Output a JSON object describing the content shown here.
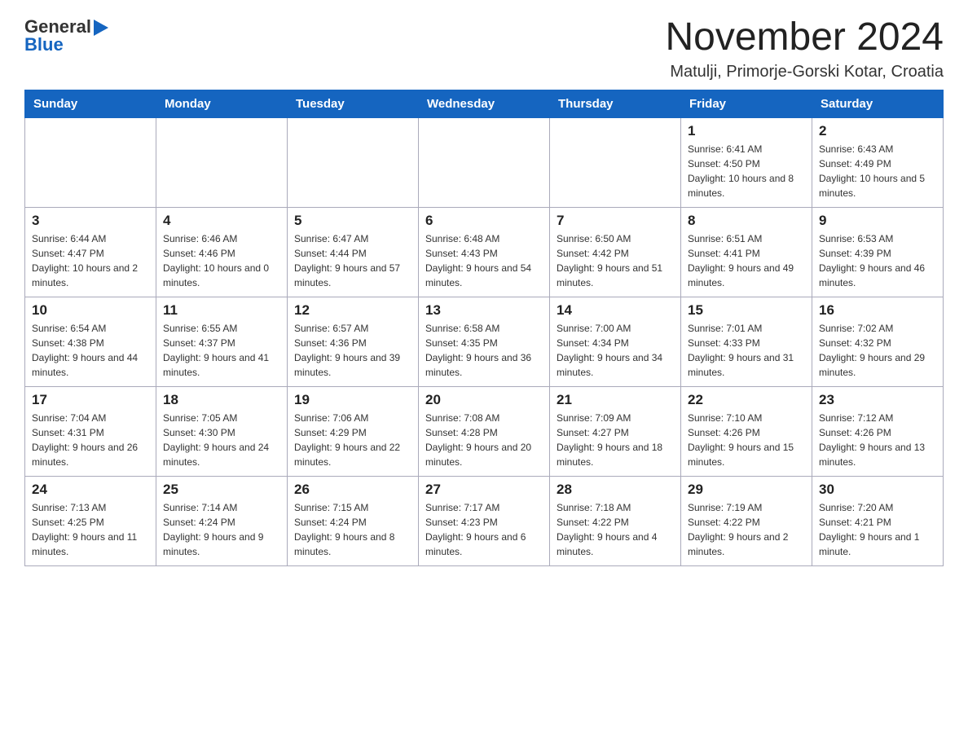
{
  "header": {
    "logo_general": "General",
    "logo_blue": "Blue",
    "month_title": "November 2024",
    "location": "Matulji, Primorje-Gorski Kotar, Croatia"
  },
  "weekdays": [
    "Sunday",
    "Monday",
    "Tuesday",
    "Wednesday",
    "Thursday",
    "Friday",
    "Saturday"
  ],
  "weeks": [
    {
      "days": [
        {
          "number": "",
          "info": ""
        },
        {
          "number": "",
          "info": ""
        },
        {
          "number": "",
          "info": ""
        },
        {
          "number": "",
          "info": ""
        },
        {
          "number": "",
          "info": ""
        },
        {
          "number": "1",
          "info": "Sunrise: 6:41 AM\nSunset: 4:50 PM\nDaylight: 10 hours and 8 minutes."
        },
        {
          "number": "2",
          "info": "Sunrise: 6:43 AM\nSunset: 4:49 PM\nDaylight: 10 hours and 5 minutes."
        }
      ]
    },
    {
      "days": [
        {
          "number": "3",
          "info": "Sunrise: 6:44 AM\nSunset: 4:47 PM\nDaylight: 10 hours and 2 minutes."
        },
        {
          "number": "4",
          "info": "Sunrise: 6:46 AM\nSunset: 4:46 PM\nDaylight: 10 hours and 0 minutes."
        },
        {
          "number": "5",
          "info": "Sunrise: 6:47 AM\nSunset: 4:44 PM\nDaylight: 9 hours and 57 minutes."
        },
        {
          "number": "6",
          "info": "Sunrise: 6:48 AM\nSunset: 4:43 PM\nDaylight: 9 hours and 54 minutes."
        },
        {
          "number": "7",
          "info": "Sunrise: 6:50 AM\nSunset: 4:42 PM\nDaylight: 9 hours and 51 minutes."
        },
        {
          "number": "8",
          "info": "Sunrise: 6:51 AM\nSunset: 4:41 PM\nDaylight: 9 hours and 49 minutes."
        },
        {
          "number": "9",
          "info": "Sunrise: 6:53 AM\nSunset: 4:39 PM\nDaylight: 9 hours and 46 minutes."
        }
      ]
    },
    {
      "days": [
        {
          "number": "10",
          "info": "Sunrise: 6:54 AM\nSunset: 4:38 PM\nDaylight: 9 hours and 44 minutes."
        },
        {
          "number": "11",
          "info": "Sunrise: 6:55 AM\nSunset: 4:37 PM\nDaylight: 9 hours and 41 minutes."
        },
        {
          "number": "12",
          "info": "Sunrise: 6:57 AM\nSunset: 4:36 PM\nDaylight: 9 hours and 39 minutes."
        },
        {
          "number": "13",
          "info": "Sunrise: 6:58 AM\nSunset: 4:35 PM\nDaylight: 9 hours and 36 minutes."
        },
        {
          "number": "14",
          "info": "Sunrise: 7:00 AM\nSunset: 4:34 PM\nDaylight: 9 hours and 34 minutes."
        },
        {
          "number": "15",
          "info": "Sunrise: 7:01 AM\nSunset: 4:33 PM\nDaylight: 9 hours and 31 minutes."
        },
        {
          "number": "16",
          "info": "Sunrise: 7:02 AM\nSunset: 4:32 PM\nDaylight: 9 hours and 29 minutes."
        }
      ]
    },
    {
      "days": [
        {
          "number": "17",
          "info": "Sunrise: 7:04 AM\nSunset: 4:31 PM\nDaylight: 9 hours and 26 minutes."
        },
        {
          "number": "18",
          "info": "Sunrise: 7:05 AM\nSunset: 4:30 PM\nDaylight: 9 hours and 24 minutes."
        },
        {
          "number": "19",
          "info": "Sunrise: 7:06 AM\nSunset: 4:29 PM\nDaylight: 9 hours and 22 minutes."
        },
        {
          "number": "20",
          "info": "Sunrise: 7:08 AM\nSunset: 4:28 PM\nDaylight: 9 hours and 20 minutes."
        },
        {
          "number": "21",
          "info": "Sunrise: 7:09 AM\nSunset: 4:27 PM\nDaylight: 9 hours and 18 minutes."
        },
        {
          "number": "22",
          "info": "Sunrise: 7:10 AM\nSunset: 4:26 PM\nDaylight: 9 hours and 15 minutes."
        },
        {
          "number": "23",
          "info": "Sunrise: 7:12 AM\nSunset: 4:26 PM\nDaylight: 9 hours and 13 minutes."
        }
      ]
    },
    {
      "days": [
        {
          "number": "24",
          "info": "Sunrise: 7:13 AM\nSunset: 4:25 PM\nDaylight: 9 hours and 11 minutes."
        },
        {
          "number": "25",
          "info": "Sunrise: 7:14 AM\nSunset: 4:24 PM\nDaylight: 9 hours and 9 minutes."
        },
        {
          "number": "26",
          "info": "Sunrise: 7:15 AM\nSunset: 4:24 PM\nDaylight: 9 hours and 8 minutes."
        },
        {
          "number": "27",
          "info": "Sunrise: 7:17 AM\nSunset: 4:23 PM\nDaylight: 9 hours and 6 minutes."
        },
        {
          "number": "28",
          "info": "Sunrise: 7:18 AM\nSunset: 4:22 PM\nDaylight: 9 hours and 4 minutes."
        },
        {
          "number": "29",
          "info": "Sunrise: 7:19 AM\nSunset: 4:22 PM\nDaylight: 9 hours and 2 minutes."
        },
        {
          "number": "30",
          "info": "Sunrise: 7:20 AM\nSunset: 4:21 PM\nDaylight: 9 hours and 1 minute."
        }
      ]
    }
  ]
}
